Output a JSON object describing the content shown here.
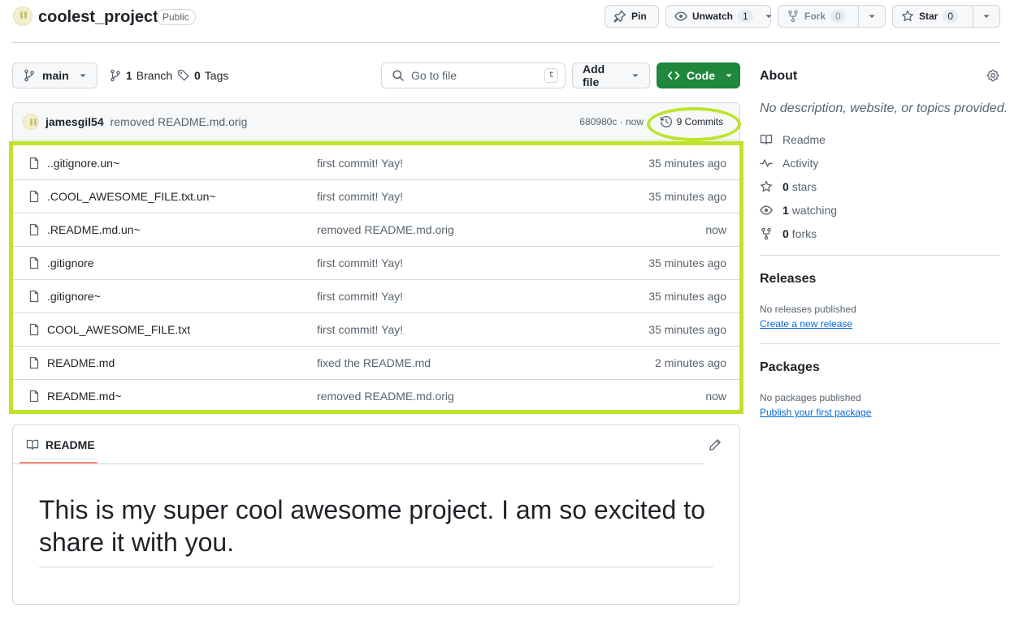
{
  "repo": {
    "name": "coolest_project",
    "visibility": "Public"
  },
  "actions": {
    "pin": "Pin",
    "unwatch": "Unwatch",
    "unwatch_count": "1",
    "fork": "Fork",
    "fork_count": "0",
    "star": "Star",
    "star_count": "0"
  },
  "toolbar": {
    "branch": "main",
    "branches_count": "1",
    "branches_label": "Branch",
    "tags_count": "0",
    "tags_label": "Tags",
    "search_placeholder": "Go to file",
    "search_kbd": "t",
    "add_file": "Add file",
    "code": "Code"
  },
  "latest_commit": {
    "author": "jamesgil54",
    "message": "removed README.md.orig",
    "sha_time": "680980c · now",
    "commits_label": "9 Commits"
  },
  "files": [
    {
      "name": "..gitignore.un~",
      "message": "first commit! Yay!",
      "age": "35 minutes ago"
    },
    {
      "name": ".COOL_AWESOME_FILE.txt.un~",
      "message": "first commit! Yay!",
      "age": "35 minutes ago"
    },
    {
      "name": ".README.md.un~",
      "message": "removed README.md.orig",
      "age": "now"
    },
    {
      "name": ".gitignore",
      "message": "first commit! Yay!",
      "age": "35 minutes ago"
    },
    {
      "name": ".gitignore~",
      "message": "first commit! Yay!",
      "age": "35 minutes ago"
    },
    {
      "name": "COOL_AWESOME_FILE.txt",
      "message": "first commit! Yay!",
      "age": "35 minutes ago"
    },
    {
      "name": "README.md",
      "message": "fixed the README.md",
      "age": "2 minutes ago"
    },
    {
      "name": "README.md~",
      "message": "removed README.md.orig",
      "age": "now"
    }
  ],
  "readme": {
    "tab": "README",
    "heading": "This is my super cool awesome project. I am so excited to share it with you."
  },
  "sidebar": {
    "about_title": "About",
    "description": "No description, website, or topics provided.",
    "readme": "Readme",
    "activity": "Activity",
    "stars_count": "0",
    "stars_label": "stars",
    "watching_count": "1",
    "watching_label": "watching",
    "forks_count": "0",
    "forks_label": "forks",
    "releases_title": "Releases",
    "releases_none": "No releases published",
    "releases_link": "Create a new release",
    "packages_title": "Packages",
    "packages_none": "No packages published",
    "packages_link": "Publish your first package"
  },
  "colors": {
    "highlight": "#bfe32a",
    "code_button": "#1f883d",
    "link": "#0969da"
  }
}
